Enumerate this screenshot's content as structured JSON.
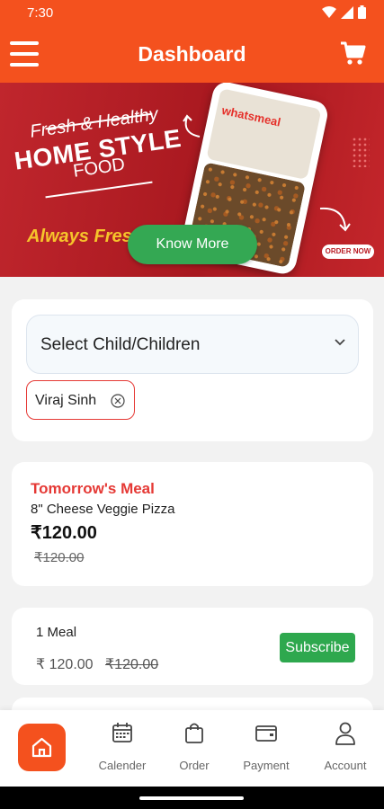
{
  "status_bar": {
    "time": "7:30"
  },
  "app_bar": {
    "title": "Dashboard"
  },
  "banner": {
    "headline_1": "Fresh & Healthy",
    "headline_2": "HOME STYLE",
    "headline_3": "FOOD",
    "tagline": "Always Fres",
    "brand": "whatsmeal",
    "order_now": "ORDER NOW",
    "cta_label": "Know More"
  },
  "child_select": {
    "label": "Select Child/Children",
    "chips": [
      {
        "name": "Viraj Sinh"
      }
    ]
  },
  "tomorrow_meal": {
    "heading": "Tomorrow's Meal",
    "item": "8\" Cheese Veggie Pizza",
    "price": "₹120.00",
    "original_price": "₹120.00"
  },
  "subscription": {
    "plan": "1 Meal",
    "price": "₹ 120.00",
    "original_price": "₹120.00",
    "button": "Subscribe"
  },
  "bottom_nav": {
    "items": [
      {
        "label": "Calender",
        "icon": "calendar-icon"
      },
      {
        "label": "Order",
        "icon": "shopping-bag-icon"
      },
      {
        "label": "Payment",
        "icon": "wallet-icon"
      },
      {
        "label": "Account",
        "icon": "person-icon"
      }
    ],
    "active": "home-icon"
  },
  "colors": {
    "primary": "#f4511e",
    "accent_red": "#e53935",
    "success_green": "#2ea84e",
    "banner_red": "#b91c24",
    "tagline_yellow": "#f6c42b"
  }
}
